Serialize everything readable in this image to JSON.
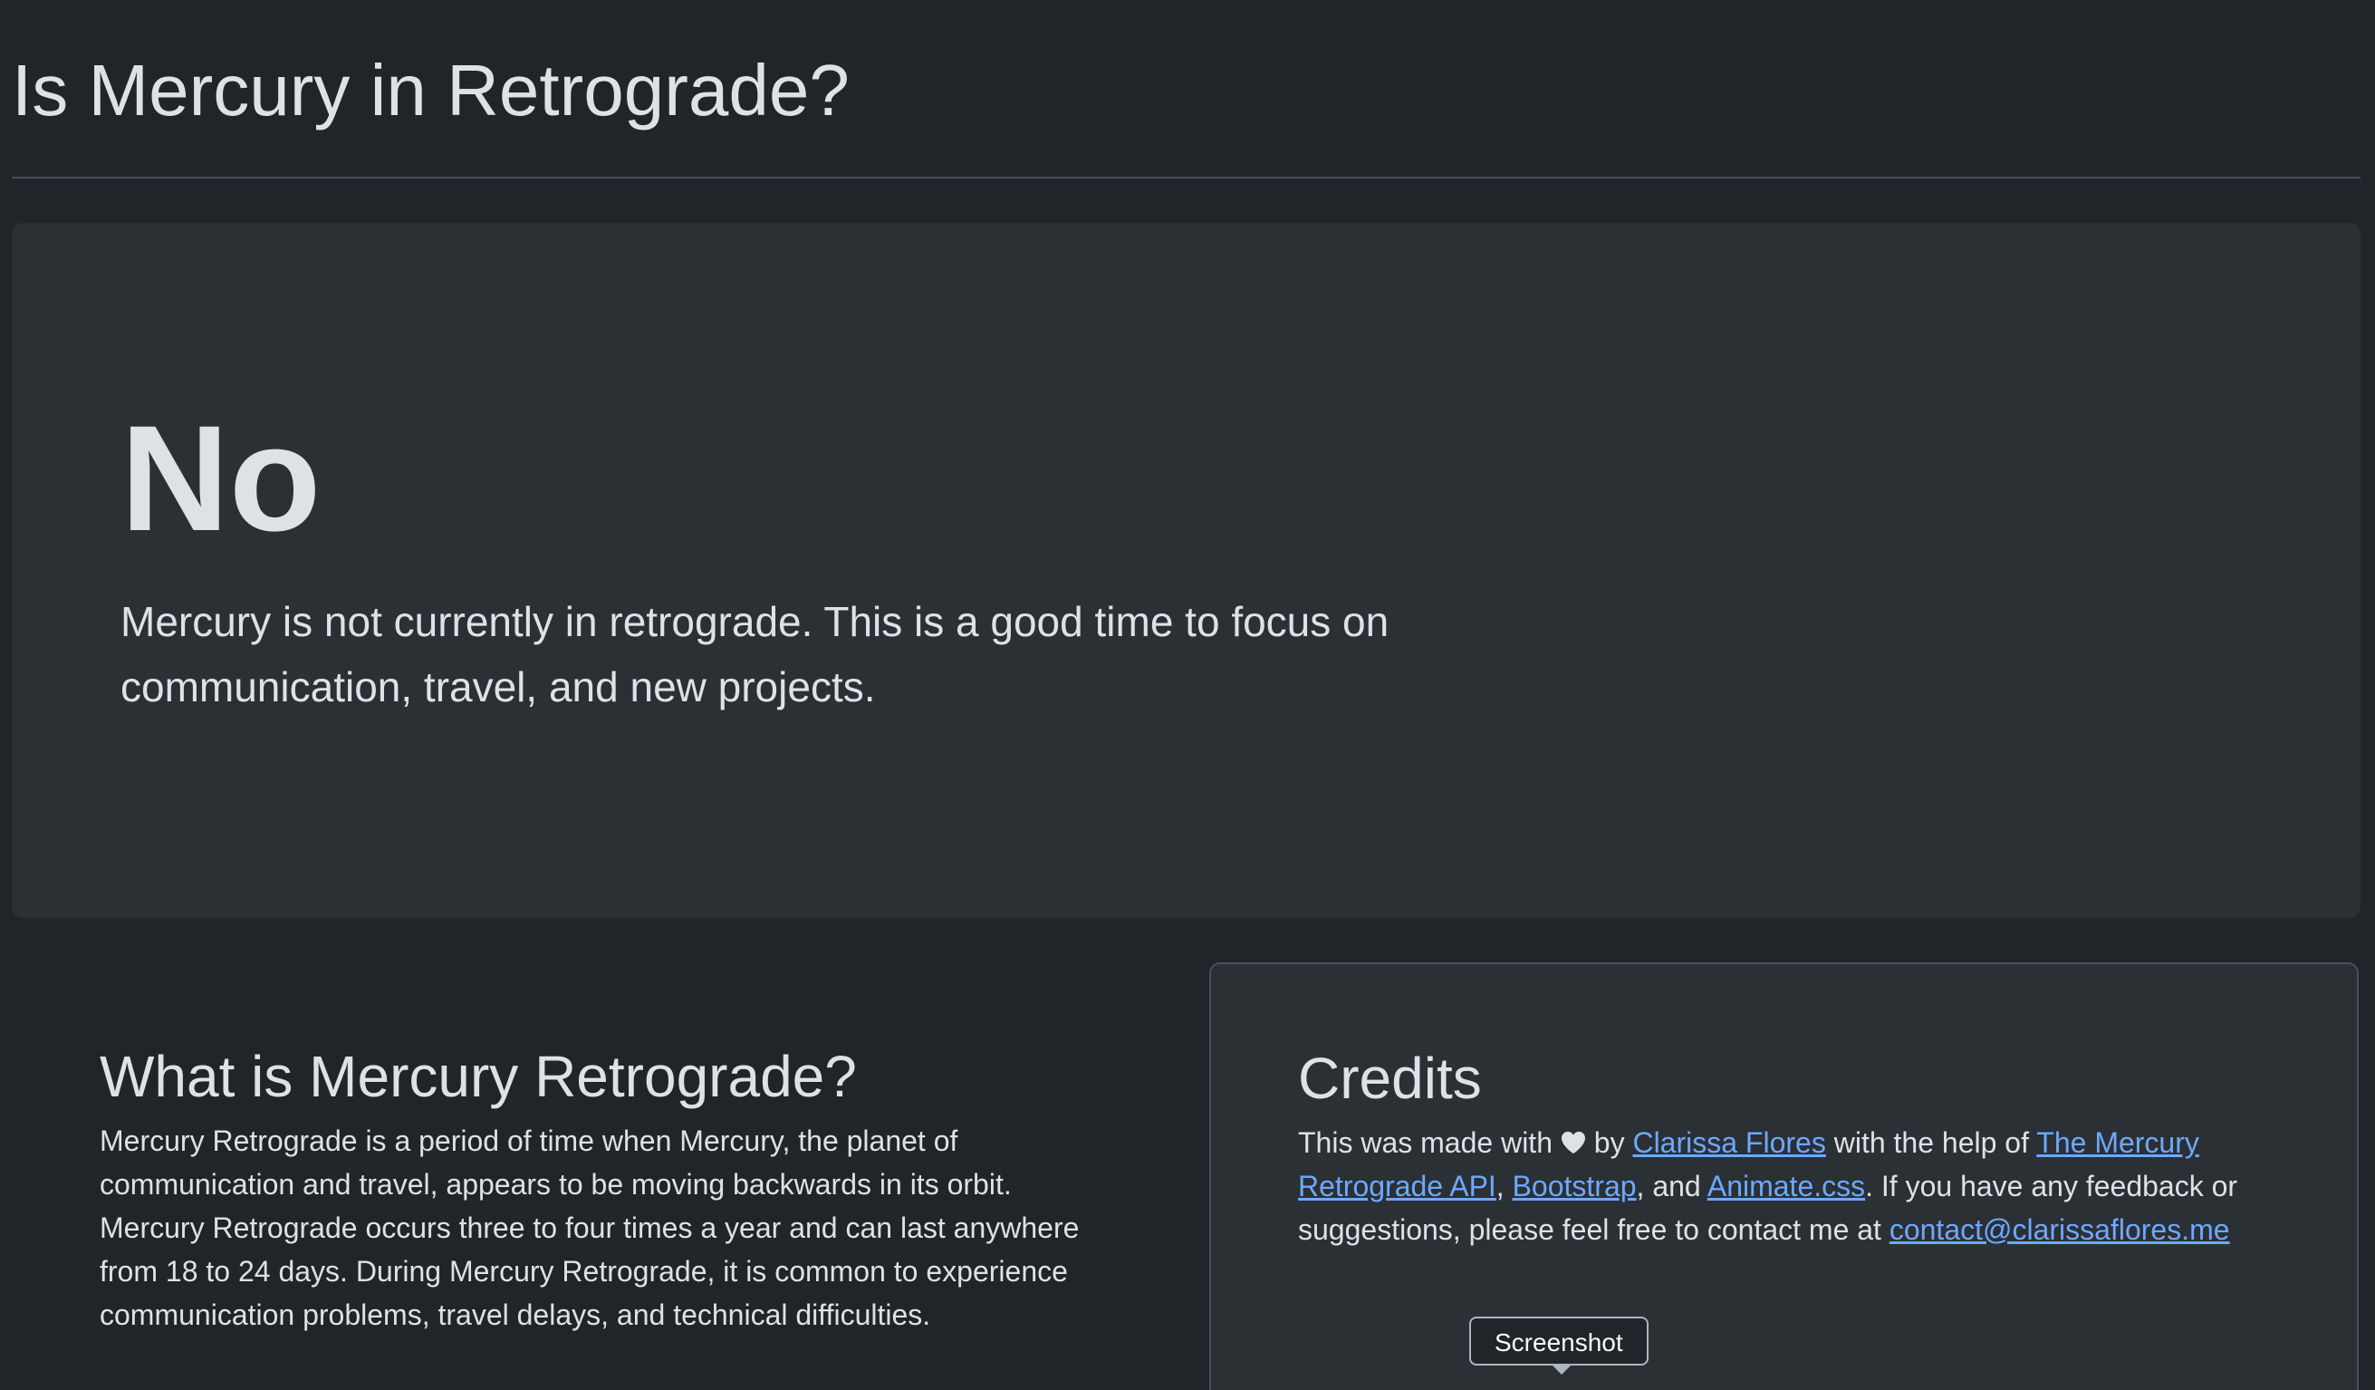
{
  "header": {
    "title": "Is Mercury in Retrograde?"
  },
  "hero": {
    "answer": "No",
    "description": "Mercury is not currently in retrograde. This is a good time to focus on communication, travel, and new projects."
  },
  "what": {
    "heading": "What is Mercury Retrograde?",
    "body": "Mercury Retrograde is a period of time when Mercury, the planet of communication and travel, appears to be moving backwards in its orbit. Mercury Retrograde occurs three to four times a year and can last anywhere from 18 to 24 days. During Mercury Retrograde, it is common to experience communication problems, travel delays, and technical difficulties."
  },
  "credits": {
    "heading": "Credits",
    "made_with": "This was made with",
    "heart_icon": "heart-icon",
    "by": "by",
    "author_link": "Clarissa Flores",
    "with_help": "with the help of",
    "api_link": "The Mercury Retrograde API",
    "comma1": ",",
    "bootstrap_link": "Bootstrap",
    "and": ", and",
    "animate_link": "Animate.css",
    "feedback": ". If you have any feedback or suggestions, please feel free to contact me at",
    "email_link": "contact@clarissaflores.me"
  },
  "tooltip": {
    "label": "Screenshot"
  },
  "colors": {
    "background": "#212529",
    "card": "#2b3035",
    "text": "#dee2e6",
    "link": "#6ea8fe"
  }
}
